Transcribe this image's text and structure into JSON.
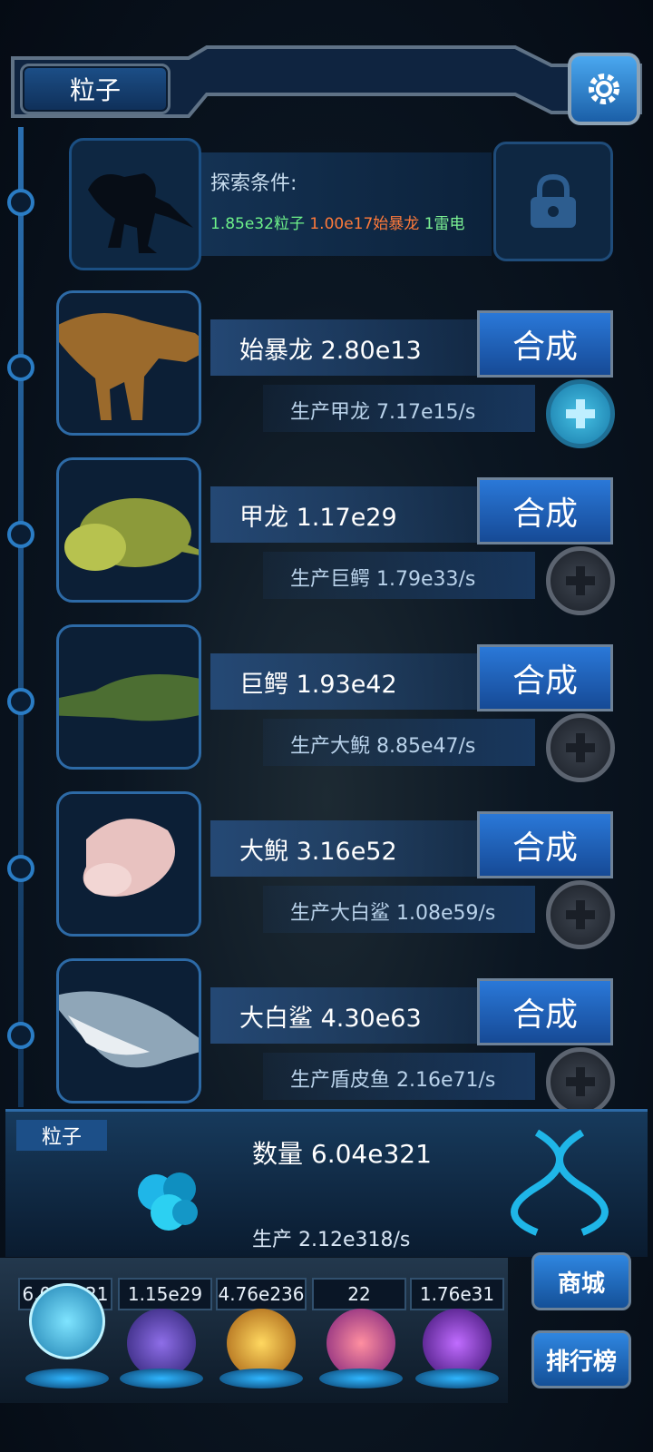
{
  "header": {
    "title": "粒子",
    "settings_icon": "gear-icon"
  },
  "locked": {
    "condition_label": "探索条件:",
    "req_particles": "1.85e32粒子",
    "req_trex": "1.00e17始暴龙",
    "req_lightning": "1雷电",
    "lock_icon": "lock-icon"
  },
  "creatures": [
    {
      "name": "始暴龙 2.80e13",
      "produce": "生产甲龙 7.17e15/s",
      "button": "合成",
      "plus_active": true
    },
    {
      "name": "甲龙 1.17e29",
      "produce": "生产巨鳄 1.79e33/s",
      "button": "合成",
      "plus_active": false
    },
    {
      "name": "巨鳄 1.93e42",
      "produce": "生产大鲵 8.85e47/s",
      "button": "合成",
      "plus_active": false
    },
    {
      "name": "大鲵 3.16e52",
      "produce": "生产大白鲨 1.08e59/s",
      "button": "合成",
      "plus_active": false
    },
    {
      "name": "大白鲨 4.30e63",
      "produce": "生产盾皮鱼 2.16e71/s",
      "button": "合成",
      "plus_active": false
    }
  ],
  "info": {
    "tab": "粒子",
    "quantity": "数量 6.04e321",
    "production": "生产 2.12e318/s"
  },
  "resources": [
    "6.04e321",
    "1.15e29",
    "4.76e236",
    "22",
    "1.76e31"
  ],
  "side_buttons": {
    "shop": "商城",
    "ranking": "排行榜"
  },
  "colors": {
    "accent": "#2a78d8",
    "req_green": "#6ef28a",
    "req_orange": "#ff7a3a"
  }
}
